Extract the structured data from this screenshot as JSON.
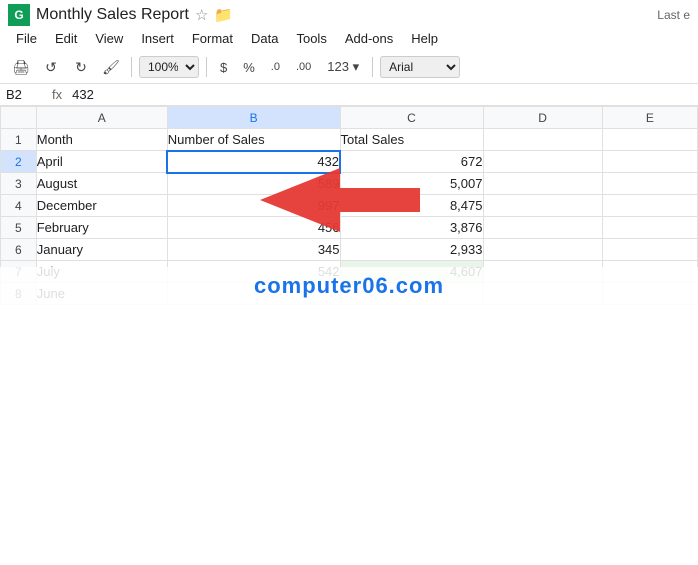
{
  "title": "Monthly Sales Report",
  "titlebar": {
    "app_icon": "G",
    "star_icon": "☆",
    "folder_icon": "🗁",
    "last_edited": "Last e"
  },
  "menu": {
    "items": [
      "File",
      "Edit",
      "View",
      "Insert",
      "Format",
      "Data",
      "Tools",
      "Add-ons",
      "Help"
    ]
  },
  "toolbar": {
    "print_icon": "🖨",
    "undo_icon": "↺",
    "redo_icon": "↻",
    "paint_icon": "🖌",
    "zoom": "100%",
    "currency_btn": "$",
    "percent_btn": "%",
    "dec_down_btn": ".0",
    "dec_up_btn": ".00",
    "num_format_btn": "123",
    "font": "Arial"
  },
  "formula_bar": {
    "cell_ref": "B2",
    "fx_label": "fx",
    "value": "432"
  },
  "columns": {
    "row_header": "",
    "A": "A",
    "B": "B",
    "C": "C",
    "D": "D",
    "E": "E"
  },
  "rows": [
    {
      "num": "1",
      "A": "Month",
      "B": "Number of Sales",
      "C": "Total Sales",
      "D": "",
      "E": ""
    },
    {
      "num": "2",
      "A": "April",
      "B": "432",
      "C": "672",
      "D": "",
      "E": ""
    },
    {
      "num": "3",
      "A": "August",
      "B": "589",
      "C": "5,007",
      "D": "",
      "E": ""
    },
    {
      "num": "4",
      "A": "December",
      "B": "997",
      "C": "8,475",
      "D": "",
      "E": ""
    },
    {
      "num": "5",
      "A": "February",
      "B": "456",
      "C": "3,876",
      "D": "",
      "E": ""
    },
    {
      "num": "6",
      "A": "January",
      "B": "345",
      "C": "2,933",
      "D": "",
      "E": ""
    },
    {
      "num": "7",
      "A": "July",
      "B": "542",
      "C": "4,607",
      "D": "",
      "E": ""
    },
    {
      "num": "8",
      "A": "June",
      "B": "",
      "C": "",
      "D": "",
      "E": ""
    }
  ],
  "watermark": "computer06.com",
  "colors": {
    "selected_border": "#1a73e8",
    "selected_bg": "#d3e3fd",
    "arrow_red": "#e53935"
  }
}
